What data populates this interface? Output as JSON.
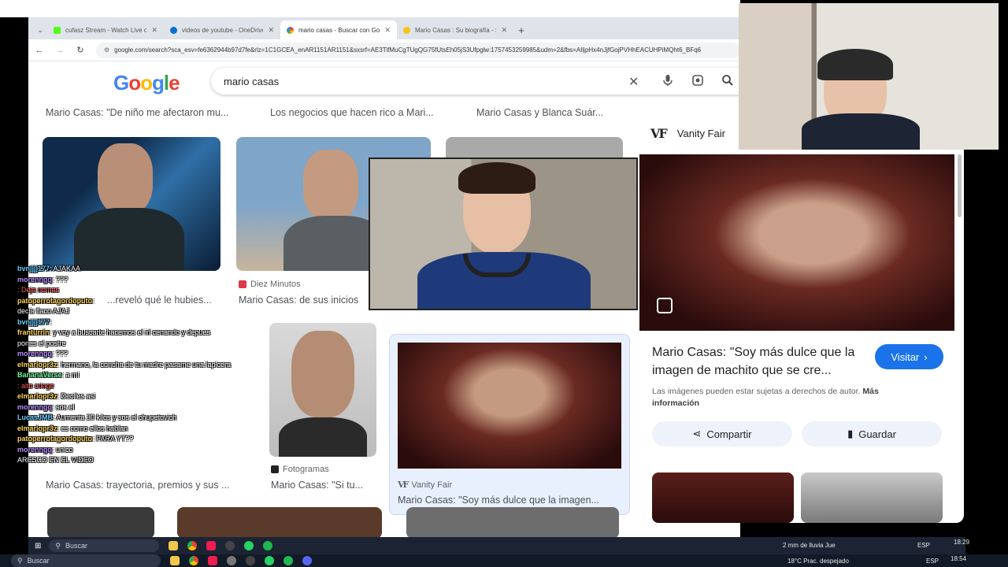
{
  "browser": {
    "tabs": [
      {
        "title": "cufasz Stream - Watch Live on K",
        "color": "#53fc18"
      },
      {
        "title": "videos de youtube - OneDrive",
        "color": "#0a6ed1"
      },
      {
        "title": "mario casas - Buscar con Google",
        "color": "#4285f4",
        "active": true
      },
      {
        "title": "Mario Casas : Su biografía - Se",
        "color": "#f5c518"
      }
    ],
    "url": "google.com/search?sca_esv=fe6362944b97d7fe&rlz=1C1GCEA_enAR1151AR1151&sxsrf=AE3TifMuCgTUgQG75fUtsEh05jS3Ufpglw:1757453259985&udm=2&fbs=AIljpHx4nJjfGojPVHhEACUHPiMQht6_BFq6"
  },
  "google": {
    "logo": "Google",
    "query": "mario casas",
    "colors": {
      "blue": "#4285f4",
      "red": "#ea4335",
      "yellow": "#fbbc05",
      "green": "#34a853"
    }
  },
  "results": {
    "top_captions": [
      "Mario Casas: \"De niño me afectaron mu...",
      "Los negocios que hacen rico a Mari...",
      "Mario Casas y Blanca Suár..."
    ],
    "row2": [
      {
        "source": "",
        "caption": "...reveló qué le hubies..."
      },
      {
        "source": "Diez Minutos",
        "caption": "Mario Casas: de sus inicios"
      }
    ],
    "row3": [
      {
        "source": "",
        "caption": "Mario Casas: trayectoria, premios y sus ..."
      },
      {
        "source": "Fotogramas",
        "caption": "Mario Casas: \"Si tu..."
      },
      {
        "source": "Vanity Fair",
        "caption": "Mario Casas: \"Soy más dulce que la imagen..."
      }
    ]
  },
  "panel": {
    "source": "Vanity Fair",
    "title": "Mario Casas: \"Soy más dulce que la imagen de machito que se cre...",
    "visit_label": "Visitar",
    "note": "Las imágenes pueden estar sujetas a derechos de autor.",
    "note_link": "Más información",
    "share_label": "Compartir",
    "save_label": "Guardar"
  },
  "chat": [
    {
      "user": "bvnjjjj177",
      "msg": ": AJAKAA",
      "color": "#66ccff"
    },
    {
      "user": "morenngq",
      "msg": ": ???",
      "color": "#b58cff"
    },
    {
      "user": "",
      "msg": ": Deja nomas",
      "color": "#ff5555"
    },
    {
      "user": "patoperrotagordoputo",
      "msg": ":",
      "color": "#ffd24d"
    },
    {
      "user": "",
      "msg": "decís flaco AJAJ",
      "color": "#ffffff"
    },
    {
      "user": "bvnjjjj177",
      "msg": ":",
      "color": "#66ccff"
    },
    {
      "user": "franturrin",
      "msg": ": y voy a buscarte hacemos el irl cenando y depues",
      "color": "#ffd24d"
    },
    {
      "user": "",
      "msg": "pones el postre",
      "color": "#ffffff"
    },
    {
      "user": "morenngq",
      "msg": ": ???",
      "color": "#b58cff"
    },
    {
      "user": "elmariopr3z",
      "msg": ": hermano, la concha de tu madre pasame una lapicera",
      "color": "#ffd24d"
    },
    {
      "user": "BananaVerse",
      "msg": ": a mi",
      "color": "#66ff99"
    },
    {
      "user": "",
      "msg": ": alto cringe",
      "color": "#ff5555"
    },
    {
      "user": "elmariopr3z",
      "msg": ": Deciles asi",
      "color": "#ffd24d"
    },
    {
      "user": "morenngq",
      "msg": ": sos el",
      "color": "#b58cff"
    },
    {
      "user": "LucasJMB",
      "msg": ": Aumenta 30 kilos y sos el chupetovich",
      "color": "#66ccff"
    },
    {
      "user": "elmariopr3z",
      "msg": ": es como ellos hablan",
      "color": "#ffd24d"
    },
    {
      "user": "patoperrotagordoputo",
      "msg": ": PARA YT??",
      "color": "#ffd24d"
    },
    {
      "user": "morenngq",
      "msg": ": unico",
      "color": "#b58cff"
    },
    {
      "user": "",
      "msg": "ARESCO EN EL VIDEO",
      "color": "#ffffff"
    }
  ],
  "taskbar": {
    "search_placeholder": "Buscar",
    "weather": "2 mm de lluvia Jue",
    "lang": "ESP",
    "time_inner": "18:29",
    "weather_outer": "18°C  Prac. despejado",
    "time_outer": "18:54"
  }
}
